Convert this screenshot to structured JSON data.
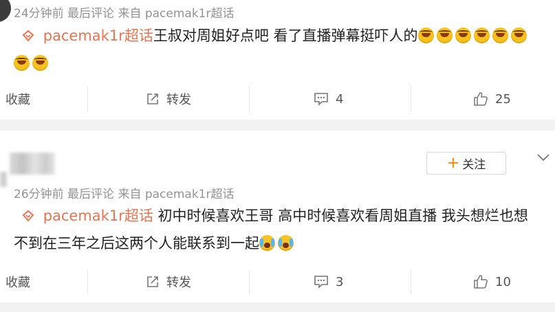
{
  "posts": [
    {
      "meta": "24分钟前 最后评论 来自 pacemak1r超话",
      "topic": "pacemak1r超话",
      "text": "王叔对周姐好点吧 看了直播弹幕挺吓人的",
      "emoji_count": 8,
      "actions": {
        "collect": "收藏",
        "repost": "转发",
        "comments": "4",
        "likes": "25"
      }
    },
    {
      "follow_label": "关注",
      "meta": "26分钟前 最后评论 来自 pacemak1r超话",
      "topic": "pacemak1r超话",
      "text_line1": "初中时候喜欢王哥 高中时候喜欢看周姐直播 我头想烂也想",
      "text_line2": "不到在三年之后这两个人能联系到一起",
      "emoji_count": 2,
      "actions": {
        "collect": "收藏",
        "repost": "转发",
        "comments": "3",
        "likes": "10"
      }
    }
  ],
  "icons": {
    "topic": "super-topic-icon",
    "emoji": "laugh-cry-emoji",
    "cry": "crying-emoji",
    "repost": "repost-icon",
    "comment": "comment-icon",
    "like": "thumbs-up-icon",
    "chevron": "chevron-down-icon"
  },
  "colors": {
    "topic": "#eb7350",
    "follow_plus": "#ff8200",
    "meta": "#939393",
    "separator": "#f2f2f2"
  }
}
